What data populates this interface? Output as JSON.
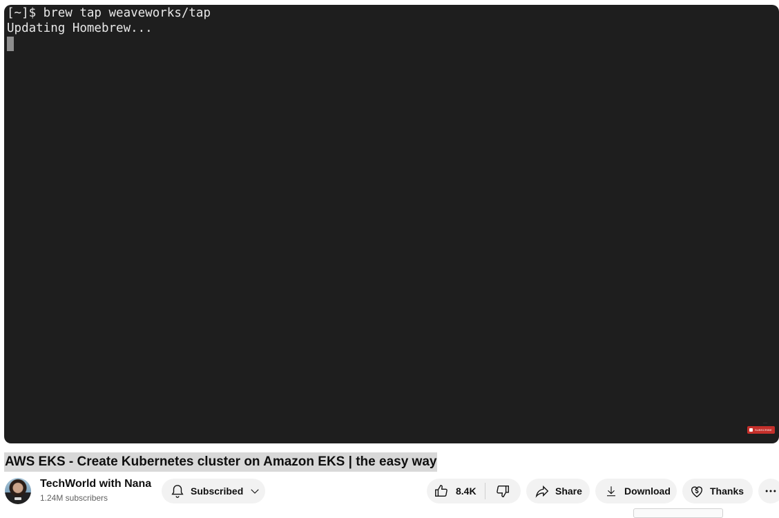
{
  "terminal": {
    "lines": [
      "[~]$ brew tap weaveworks/tap",
      "Updating Homebrew..."
    ]
  },
  "watermark": {
    "label": "SUBSCRIBE",
    "color": "#c4302b"
  },
  "video": {
    "title": "AWS EKS - Create Kubernetes cluster on Amazon EKS | the easy way"
  },
  "channel": {
    "name": "TechWorld with Nana",
    "subscribers": "1.24M subscribers"
  },
  "actions": {
    "subscribed_label": "Subscribed",
    "like_count": "8.4K",
    "share_label": "Share",
    "download_label": "Download",
    "thanks_label": "Thanks"
  },
  "icons": [
    "bell-icon",
    "chevron-down-icon",
    "thumbs-up-icon",
    "thumbs-down-icon",
    "share-arrow-icon",
    "download-icon",
    "thanks-heart-dollar-icon",
    "more-horizontal-icon"
  ],
  "colors": {
    "terminal_bg": "#1e1e1e",
    "pill_bg": "#f2f2f2",
    "title_highlight": "#d8d8d8"
  }
}
